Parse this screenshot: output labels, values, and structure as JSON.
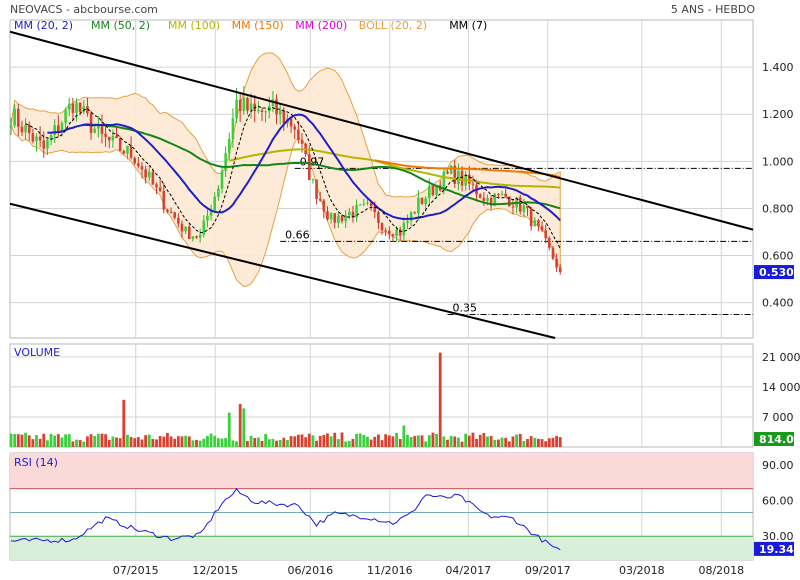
{
  "header": {
    "title": "NEOVACS - abcbourse.com",
    "period": "5 ANS - HEBDO"
  },
  "chart_data": [
    {
      "type": "line",
      "panel": "price",
      "legend": [
        {
          "name": "MM (20, 2)",
          "color": "#1f1fc8"
        },
        {
          "name": "MM (50, 2)",
          "color": "#178417"
        },
        {
          "name": "MM (100)",
          "color": "#b5b500"
        },
        {
          "name": "MM (150)",
          "color": "#f07800"
        },
        {
          "name": "MM (200)",
          "color": "#e000e0"
        },
        {
          "name": "BOLL (20, 2)",
          "color": "#e8a040"
        },
        {
          "name": "MM (7)",
          "color": "#000000"
        }
      ],
      "ylim": [
        0.25,
        1.6
      ],
      "yticks": [
        {
          "value": 1.4,
          "label": "1.400"
        },
        {
          "value": 1.2,
          "label": "1.200"
        },
        {
          "value": 1.0,
          "label": "1.000"
        },
        {
          "value": 0.8,
          "label": "0.800"
        },
        {
          "value": 0.6,
          "label": "0.600"
        },
        {
          "value": 0.4,
          "label": "0.400"
        }
      ],
      "last_price": {
        "value": 0.53,
        "label": "0.530"
      },
      "levels": [
        {
          "value": 0.97,
          "label": "0.97",
          "from": "2016-05-02"
        },
        {
          "value": 0.66,
          "label": "0.66",
          "from": "2016-04-04"
        },
        {
          "value": 0.35,
          "label": "0.35",
          "from": "2017-02-20"
        }
      ],
      "channel_upper": [
        [
          "2014-11-01",
          1.55
        ],
        [
          "2018-10-01",
          0.71
        ]
      ],
      "channel_lower": [
        [
          "2014-11-01",
          0.82
        ],
        [
          "2017-09-15",
          0.25
        ]
      ],
      "close_anchors": [
        [
          "2014-11-03",
          1.2
        ],
        [
          "2015-01-05",
          1.05
        ],
        [
          "2015-03-02",
          1.25
        ],
        [
          "2015-04-27",
          1.1
        ],
        [
          "2015-06-29",
          1.02
        ],
        [
          "2015-08-31",
          0.8
        ],
        [
          "2015-10-05",
          0.7
        ],
        [
          "2015-11-02",
          0.68
        ],
        [
          "2015-12-07",
          0.9
        ],
        [
          "2016-01-11",
          1.25
        ],
        [
          "2016-02-15",
          1.2
        ],
        [
          "2016-03-21",
          1.22
        ],
        [
          "2016-05-02",
          1.15
        ],
        [
          "2016-06-06",
          0.9
        ],
        [
          "2016-07-11",
          0.75
        ],
        [
          "2016-08-15",
          0.78
        ],
        [
          "2016-09-19",
          0.8
        ],
        [
          "2016-10-24",
          0.72
        ],
        [
          "2016-11-21",
          0.7
        ],
        [
          "2016-12-26",
          0.82
        ],
        [
          "2017-01-30",
          0.9
        ],
        [
          "2017-02-27",
          0.95
        ],
        [
          "2017-04-03",
          0.9
        ],
        [
          "2017-05-08",
          0.84
        ],
        [
          "2017-06-12",
          0.85
        ],
        [
          "2017-07-17",
          0.8
        ],
        [
          "2017-08-21",
          0.68
        ],
        [
          "2017-09-25",
          0.53
        ]
      ]
    },
    {
      "type": "bar",
      "panel": "volume",
      "label": "VOLUME",
      "ylim": [
        0,
        24000
      ],
      "yticks": [
        {
          "value": 21000,
          "label": "21 000"
        },
        {
          "value": 14000,
          "label": "14 000"
        },
        {
          "value": 7000,
          "label": "7 000"
        }
      ],
      "last": {
        "value": 814,
        "label": "814.0"
      },
      "spikes": [
        {
          "date": "2015-06-08",
          "value": 11000
        },
        {
          "date": "2015-12-28",
          "value": 8000
        },
        {
          "date": "2016-01-18",
          "value": 10000
        },
        {
          "date": "2016-01-25",
          "value": 9000
        },
        {
          "date": "2016-11-28",
          "value": 5000
        },
        {
          "date": "2017-02-06",
          "value": 22000
        }
      ]
    },
    {
      "type": "line",
      "panel": "rsi",
      "label": "RSI (14)",
      "ylim": [
        10,
        100
      ],
      "yticks": [
        {
          "value": 90,
          "label": "90.00"
        },
        {
          "value": 60,
          "label": "60.00"
        },
        {
          "value": 30,
          "label": "30.00"
        }
      ],
      "overbought": 70,
      "oversold": 30,
      "last": {
        "value": 19.34,
        "label": "19.34"
      },
      "anchors": [
        [
          "2014-11-03",
          26
        ],
        [
          "2015-03-02",
          27
        ],
        [
          "2015-05-04",
          45
        ],
        [
          "2015-07-06",
          35
        ],
        [
          "2015-09-07",
          28
        ],
        [
          "2015-11-02",
          31
        ],
        [
          "2015-12-14",
          58
        ],
        [
          "2016-01-11",
          68
        ],
        [
          "2016-02-15",
          59
        ],
        [
          "2016-04-04",
          57
        ],
        [
          "2016-05-09",
          56
        ],
        [
          "2016-06-13",
          40
        ],
        [
          "2016-07-18",
          49
        ],
        [
          "2016-09-19",
          46
        ],
        [
          "2016-11-07",
          41
        ],
        [
          "2016-12-12",
          49
        ],
        [
          "2017-01-09",
          65
        ],
        [
          "2017-02-13",
          62
        ],
        [
          "2017-03-13",
          64
        ],
        [
          "2017-05-08",
          47
        ],
        [
          "2017-06-26",
          45
        ],
        [
          "2017-08-07",
          31
        ],
        [
          "2017-09-25",
          17
        ]
      ]
    }
  ],
  "xaxis": {
    "ticks": [
      {
        "date": "2015-07-01",
        "label": "07/2015"
      },
      {
        "date": "2015-12-01",
        "label": "12/2015"
      },
      {
        "date": "2016-06-01",
        "label": "06/2016"
      },
      {
        "date": "2016-11-01",
        "label": "11/2016"
      },
      {
        "date": "2017-04-01",
        "label": "04/2017"
      },
      {
        "date": "2017-09-01",
        "label": "09/2017"
      },
      {
        "date": "2018-03-01",
        "label": "03/2018"
      },
      {
        "date": "2018-08-01",
        "label": "08/2018"
      }
    ]
  }
}
